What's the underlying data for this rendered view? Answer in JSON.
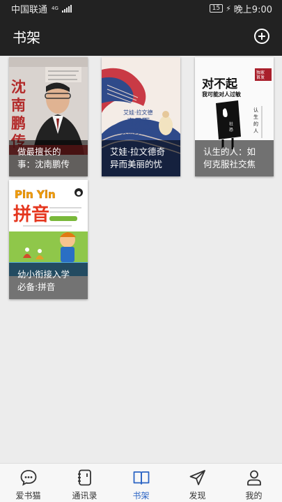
{
  "status_bar": {
    "carrier": "中国联通",
    "network": "4G",
    "battery": "15",
    "time": "晚上9:00"
  },
  "header": {
    "title": "书架",
    "add_icon": "plus-circle-icon"
  },
  "books": [
    {
      "title_line1": "做最擅长的",
      "title_line2": "事：沈南鹏传",
      "cover_text": "沈南鹏传"
    },
    {
      "title_line1": "艾娃·拉文德奇",
      "title_line2": "异而美丽的忧",
      "cover_text_line1": "艾娃·拉文德",
      "cover_text_line2": "奇异而",
      "cover_text_line3": "美丽的忧伤"
    },
    {
      "title_line1": "认生的人：如",
      "title_line2": "何克服社交焦",
      "cover_text_line1": "对不起",
      "cover_text_line2": "我可能对人过敏",
      "cover_badge": "独家首发",
      "cover_side": "认生的人"
    },
    {
      "title_line1": "幼小衔接入学",
      "title_line2": "必备:拼音",
      "cover_text_line1": "Pin Yin",
      "cover_text_line2": "拼音"
    }
  ],
  "tabs": [
    {
      "label": "爱书猫",
      "icon": "chat-bubble-icon"
    },
    {
      "label": "通讯录",
      "icon": "address-book-icon"
    },
    {
      "label": "书架",
      "icon": "open-book-icon"
    },
    {
      "label": "发现",
      "icon": "paper-plane-icon"
    },
    {
      "label": "我的",
      "icon": "person-icon"
    }
  ],
  "colors": {
    "bar_bg": "#222222",
    "shelf_bg": "#ececec",
    "tab_active": "#2b64c4",
    "tab_inactive": "#333333"
  }
}
